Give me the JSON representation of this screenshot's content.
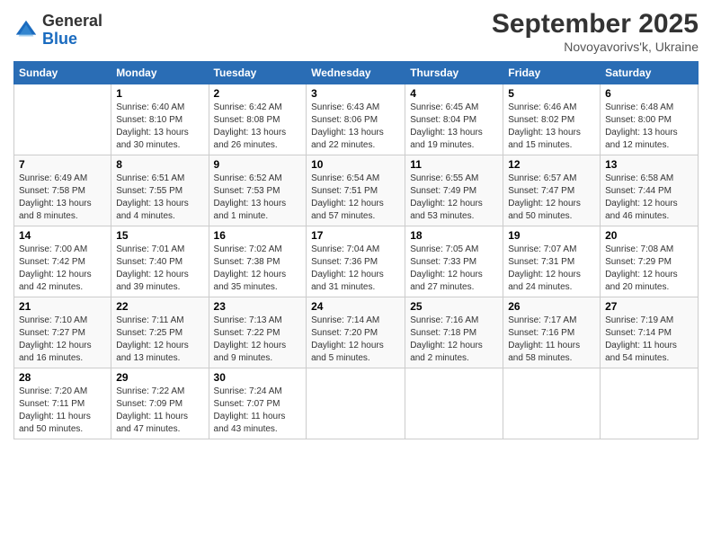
{
  "header": {
    "logo_general": "General",
    "logo_blue": "Blue",
    "month_title": "September 2025",
    "location": "Novoyavorivs'k, Ukraine"
  },
  "days_of_week": [
    "Sunday",
    "Monday",
    "Tuesday",
    "Wednesday",
    "Thursday",
    "Friday",
    "Saturday"
  ],
  "weeks": [
    [
      {
        "day": "",
        "sunrise": "",
        "sunset": "",
        "daylight": ""
      },
      {
        "day": "1",
        "sunrise": "Sunrise: 6:40 AM",
        "sunset": "Sunset: 8:10 PM",
        "daylight": "Daylight: 13 hours and 30 minutes."
      },
      {
        "day": "2",
        "sunrise": "Sunrise: 6:42 AM",
        "sunset": "Sunset: 8:08 PM",
        "daylight": "Daylight: 13 hours and 26 minutes."
      },
      {
        "day": "3",
        "sunrise": "Sunrise: 6:43 AM",
        "sunset": "Sunset: 8:06 PM",
        "daylight": "Daylight: 13 hours and 22 minutes."
      },
      {
        "day": "4",
        "sunrise": "Sunrise: 6:45 AM",
        "sunset": "Sunset: 8:04 PM",
        "daylight": "Daylight: 13 hours and 19 minutes."
      },
      {
        "day": "5",
        "sunrise": "Sunrise: 6:46 AM",
        "sunset": "Sunset: 8:02 PM",
        "daylight": "Daylight: 13 hours and 15 minutes."
      },
      {
        "day": "6",
        "sunrise": "Sunrise: 6:48 AM",
        "sunset": "Sunset: 8:00 PM",
        "daylight": "Daylight: 13 hours and 12 minutes."
      }
    ],
    [
      {
        "day": "7",
        "sunrise": "Sunrise: 6:49 AM",
        "sunset": "Sunset: 7:58 PM",
        "daylight": "Daylight: 13 hours and 8 minutes."
      },
      {
        "day": "8",
        "sunrise": "Sunrise: 6:51 AM",
        "sunset": "Sunset: 7:55 PM",
        "daylight": "Daylight: 13 hours and 4 minutes."
      },
      {
        "day": "9",
        "sunrise": "Sunrise: 6:52 AM",
        "sunset": "Sunset: 7:53 PM",
        "daylight": "Daylight: 13 hours and 1 minute."
      },
      {
        "day": "10",
        "sunrise": "Sunrise: 6:54 AM",
        "sunset": "Sunset: 7:51 PM",
        "daylight": "Daylight: 12 hours and 57 minutes."
      },
      {
        "day": "11",
        "sunrise": "Sunrise: 6:55 AM",
        "sunset": "Sunset: 7:49 PM",
        "daylight": "Daylight: 12 hours and 53 minutes."
      },
      {
        "day": "12",
        "sunrise": "Sunrise: 6:57 AM",
        "sunset": "Sunset: 7:47 PM",
        "daylight": "Daylight: 12 hours and 50 minutes."
      },
      {
        "day": "13",
        "sunrise": "Sunrise: 6:58 AM",
        "sunset": "Sunset: 7:44 PM",
        "daylight": "Daylight: 12 hours and 46 minutes."
      }
    ],
    [
      {
        "day": "14",
        "sunrise": "Sunrise: 7:00 AM",
        "sunset": "Sunset: 7:42 PM",
        "daylight": "Daylight: 12 hours and 42 minutes."
      },
      {
        "day": "15",
        "sunrise": "Sunrise: 7:01 AM",
        "sunset": "Sunset: 7:40 PM",
        "daylight": "Daylight: 12 hours and 39 minutes."
      },
      {
        "day": "16",
        "sunrise": "Sunrise: 7:02 AM",
        "sunset": "Sunset: 7:38 PM",
        "daylight": "Daylight: 12 hours and 35 minutes."
      },
      {
        "day": "17",
        "sunrise": "Sunrise: 7:04 AM",
        "sunset": "Sunset: 7:36 PM",
        "daylight": "Daylight: 12 hours and 31 minutes."
      },
      {
        "day": "18",
        "sunrise": "Sunrise: 7:05 AM",
        "sunset": "Sunset: 7:33 PM",
        "daylight": "Daylight: 12 hours and 27 minutes."
      },
      {
        "day": "19",
        "sunrise": "Sunrise: 7:07 AM",
        "sunset": "Sunset: 7:31 PM",
        "daylight": "Daylight: 12 hours and 24 minutes."
      },
      {
        "day": "20",
        "sunrise": "Sunrise: 7:08 AM",
        "sunset": "Sunset: 7:29 PM",
        "daylight": "Daylight: 12 hours and 20 minutes."
      }
    ],
    [
      {
        "day": "21",
        "sunrise": "Sunrise: 7:10 AM",
        "sunset": "Sunset: 7:27 PM",
        "daylight": "Daylight: 12 hours and 16 minutes."
      },
      {
        "day": "22",
        "sunrise": "Sunrise: 7:11 AM",
        "sunset": "Sunset: 7:25 PM",
        "daylight": "Daylight: 12 hours and 13 minutes."
      },
      {
        "day": "23",
        "sunrise": "Sunrise: 7:13 AM",
        "sunset": "Sunset: 7:22 PM",
        "daylight": "Daylight: 12 hours and 9 minutes."
      },
      {
        "day": "24",
        "sunrise": "Sunrise: 7:14 AM",
        "sunset": "Sunset: 7:20 PM",
        "daylight": "Daylight: 12 hours and 5 minutes."
      },
      {
        "day": "25",
        "sunrise": "Sunrise: 7:16 AM",
        "sunset": "Sunset: 7:18 PM",
        "daylight": "Daylight: 12 hours and 2 minutes."
      },
      {
        "day": "26",
        "sunrise": "Sunrise: 7:17 AM",
        "sunset": "Sunset: 7:16 PM",
        "daylight": "Daylight: 11 hours and 58 minutes."
      },
      {
        "day": "27",
        "sunrise": "Sunrise: 7:19 AM",
        "sunset": "Sunset: 7:14 PM",
        "daylight": "Daylight: 11 hours and 54 minutes."
      }
    ],
    [
      {
        "day": "28",
        "sunrise": "Sunrise: 7:20 AM",
        "sunset": "Sunset: 7:11 PM",
        "daylight": "Daylight: 11 hours and 50 minutes."
      },
      {
        "day": "29",
        "sunrise": "Sunrise: 7:22 AM",
        "sunset": "Sunset: 7:09 PM",
        "daylight": "Daylight: 11 hours and 47 minutes."
      },
      {
        "day": "30",
        "sunrise": "Sunrise: 7:24 AM",
        "sunset": "Sunset: 7:07 PM",
        "daylight": "Daylight: 11 hours and 43 minutes."
      },
      {
        "day": "",
        "sunrise": "",
        "sunset": "",
        "daylight": ""
      },
      {
        "day": "",
        "sunrise": "",
        "sunset": "",
        "daylight": ""
      },
      {
        "day": "",
        "sunrise": "",
        "sunset": "",
        "daylight": ""
      },
      {
        "day": "",
        "sunrise": "",
        "sunset": "",
        "daylight": ""
      }
    ]
  ]
}
